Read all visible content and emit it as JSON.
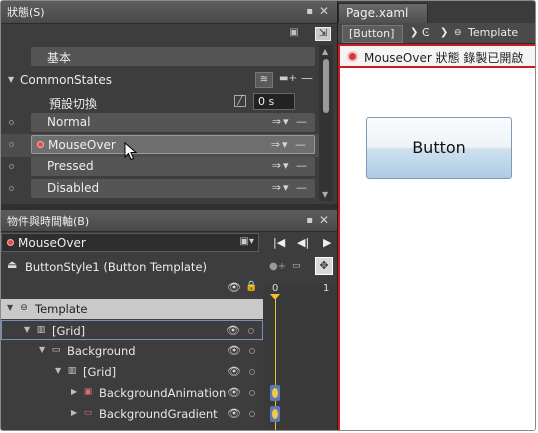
{
  "states_panel": {
    "title": "狀態(S)",
    "base_label": "基本",
    "group_name": "CommonStates",
    "default_transition_label": "預設切換",
    "default_transition_value": "0 s",
    "states": [
      {
        "label": "Normal",
        "selected": false,
        "recording": false
      },
      {
        "label": "MouseOver",
        "selected": true,
        "recording": true
      },
      {
        "label": "Pressed",
        "selected": false,
        "recording": false
      },
      {
        "label": "Disabled",
        "selected": false,
        "recording": false
      }
    ]
  },
  "objects_panel": {
    "title": "物件與時間軸(B)",
    "current_state": "MouseOver",
    "template_scope": "ButtonStyle1 (Button Template)",
    "tree": [
      {
        "label": "Template",
        "indent": 0,
        "expanded": true
      },
      {
        "label": "[Grid]",
        "indent": 1,
        "expanded": true
      },
      {
        "label": "Background",
        "indent": 2,
        "expanded": true
      },
      {
        "label": "[Grid]",
        "indent": 3,
        "expanded": true
      },
      {
        "label": "BackgroundAnimation",
        "indent": 4,
        "expanded": false
      },
      {
        "label": "BackgroundGradient",
        "indent": 4,
        "expanded": false
      }
    ],
    "ruler_ticks": [
      "0",
      "1"
    ]
  },
  "document": {
    "tab_title": "Page.xaml",
    "breadcrumb": [
      "[Button]",
      "Template"
    ],
    "recording_banner": "MouseOver 狀態 錄製已開啟",
    "preview_button_label": "Button"
  },
  "colors": {
    "recording_red": "#c81e1e",
    "playhead": "#f0c030",
    "keyframe": "#5e7ab0"
  }
}
